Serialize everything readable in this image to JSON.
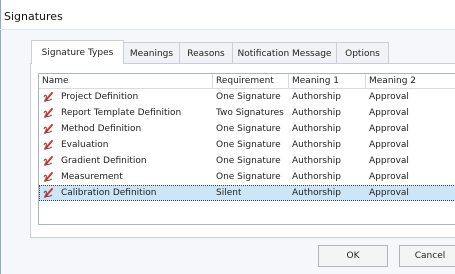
{
  "window": {
    "title": "Signatures"
  },
  "tabs": [
    {
      "label": "Signature Types"
    },
    {
      "label": "Meanings"
    },
    {
      "label": "Reasons"
    },
    {
      "label": "Notification Message"
    },
    {
      "label": "Options"
    }
  ],
  "table": {
    "columns": [
      "Name",
      "Requirement",
      "Meaning 1",
      "Meaning 2"
    ],
    "rows": [
      {
        "name": "Project Definition",
        "requirement": "One Signature",
        "meaning1": "Authorship",
        "meaning2": "Approval"
      },
      {
        "name": "Report Template Definition",
        "requirement": "Two Signatures",
        "meaning1": "Authorship",
        "meaning2": "Approval"
      },
      {
        "name": "Method Definition",
        "requirement": "One Signature",
        "meaning1": "Authorship",
        "meaning2": "Approval"
      },
      {
        "name": "Evaluation",
        "requirement": "One Signature",
        "meaning1": "Authorship",
        "meaning2": "Approval"
      },
      {
        "name": "Gradient Definition",
        "requirement": "One Signature",
        "meaning1": "Authorship",
        "meaning2": "Approval"
      },
      {
        "name": "Measurement",
        "requirement": "One Signature",
        "meaning1": "Authorship",
        "meaning2": "Approval"
      },
      {
        "name": "Calibration Definition",
        "requirement": "Silent",
        "meaning1": "Authorship",
        "meaning2": "Approval"
      }
    ],
    "selected_row": "Calibration Definition",
    "row_icon": "signature-pen-icon"
  },
  "buttons": {
    "ok": "OK",
    "cancel": "Cancel"
  },
  "colors": {
    "selection": "#cde6f7",
    "icon_red": "#d9342b"
  }
}
